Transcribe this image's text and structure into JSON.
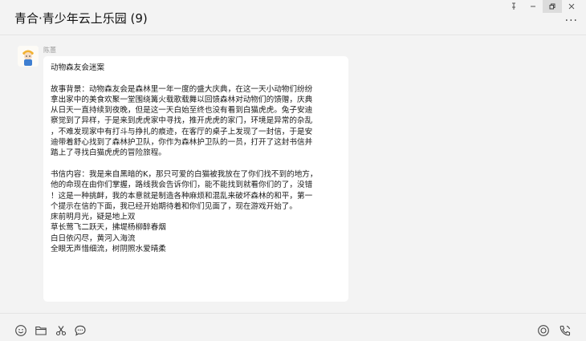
{
  "window": {
    "title": "青合·青少年云上乐园 (9)",
    "controls": [
      "pin-icon",
      "minimize-icon",
      "restore-icon",
      "close-icon"
    ],
    "more_label": "···"
  },
  "message": {
    "sender": "陈蕙",
    "lines": [
      "动物森友会迷案",
      "",
      "故事背景：动物森友会是森林里一年一度的盛大庆典，在这一天小动物们纷纷",
      "拿出家中的美食欢聚一堂围绕篝火载歌载舞以回馈森林对动物们的馈赠，庆典",
      "从日天一直持续到夜晚，但是这一天白始至终也没有看到白猫虎虎。兔子安迪",
      "察觉到了异样，于是来到虎虎家中寻找，推开虎虎的家门，环境是异常的杂乱",
      "，不难发现家中有打斗与挣扎的痕迹，在客厅的桌子上发现了一封信，于是安",
      "迪带着舒心找到了森林护卫队，你作为森林护卫队的一员，打开了这封书信并",
      "踏上了寻找白猫虎虎的冒险旅程。",
      "",
      "书信内容：我是来自黑暗的K，那只可爱的白猫被我放在了你们找不到的地方，",
      "他的命现在由你们掌握，路线我会告诉你们，能不能找到就看你们的了，没错",
      "！这是一种挑衅，我的本意就是制造各种麻烦和混乱来破坏森林的和平，第一",
      "个提示在信的下面，我已经开始期待着和你们见面了，现在游戏开始了。",
      "床前明月光，疑是地上双",
      "草长莺飞二跃天，拂堤杨柳醉春烟",
      "白日依闪尽，黄河入海流",
      "全眼无声惜细流，树阴照水爱晴柔"
    ]
  },
  "toolbar": {
    "left_icons": [
      "emoji-icon",
      "folder-icon",
      "scissors-icon",
      "chat-bubble-icon"
    ],
    "right_icons": [
      "record-icon",
      "call-icon"
    ]
  },
  "colors": {
    "background": "#f3f3f3",
    "bubble": "#ffffff",
    "sender": "#9a9a9a"
  }
}
